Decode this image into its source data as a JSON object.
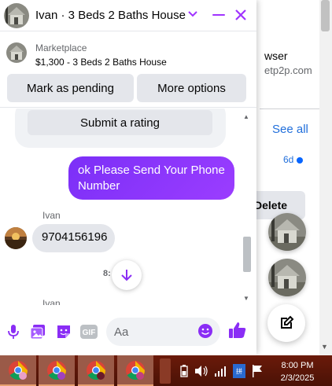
{
  "background": {
    "text_fragment_1": "wser",
    "text_fragment_2": "etp2p.com",
    "see_all": "See all",
    "age": "6d",
    "delete_fragment": "Delete"
  },
  "chat": {
    "header_title": "Ivan · 3 Beds 2 Baths House",
    "marketplace_label": "Marketplace",
    "listing_title": "$1,300 - 3 Beds 2 Baths House",
    "mark_pending": "Mark as pending",
    "more_options": "More options",
    "submit_rating": "Submit a rating",
    "messages": [
      {
        "direction": "out",
        "text": "ok Please Send Your Phone Number"
      },
      {
        "direction": "in",
        "sender": "Ivan",
        "text": "9704156196"
      },
      {
        "direction": "in",
        "sender": "Ivan",
        "text": ""
      }
    ],
    "time_fragment": "8:",
    "input_placeholder": "Aa",
    "accent_color": "#8a2df5"
  },
  "taskbar": {
    "apps": [
      "chrome-icon",
      "chrome-icon",
      "chrome-icon",
      "chrome-icon"
    ],
    "time": "8:00 PM",
    "date": "2/3/2025"
  }
}
